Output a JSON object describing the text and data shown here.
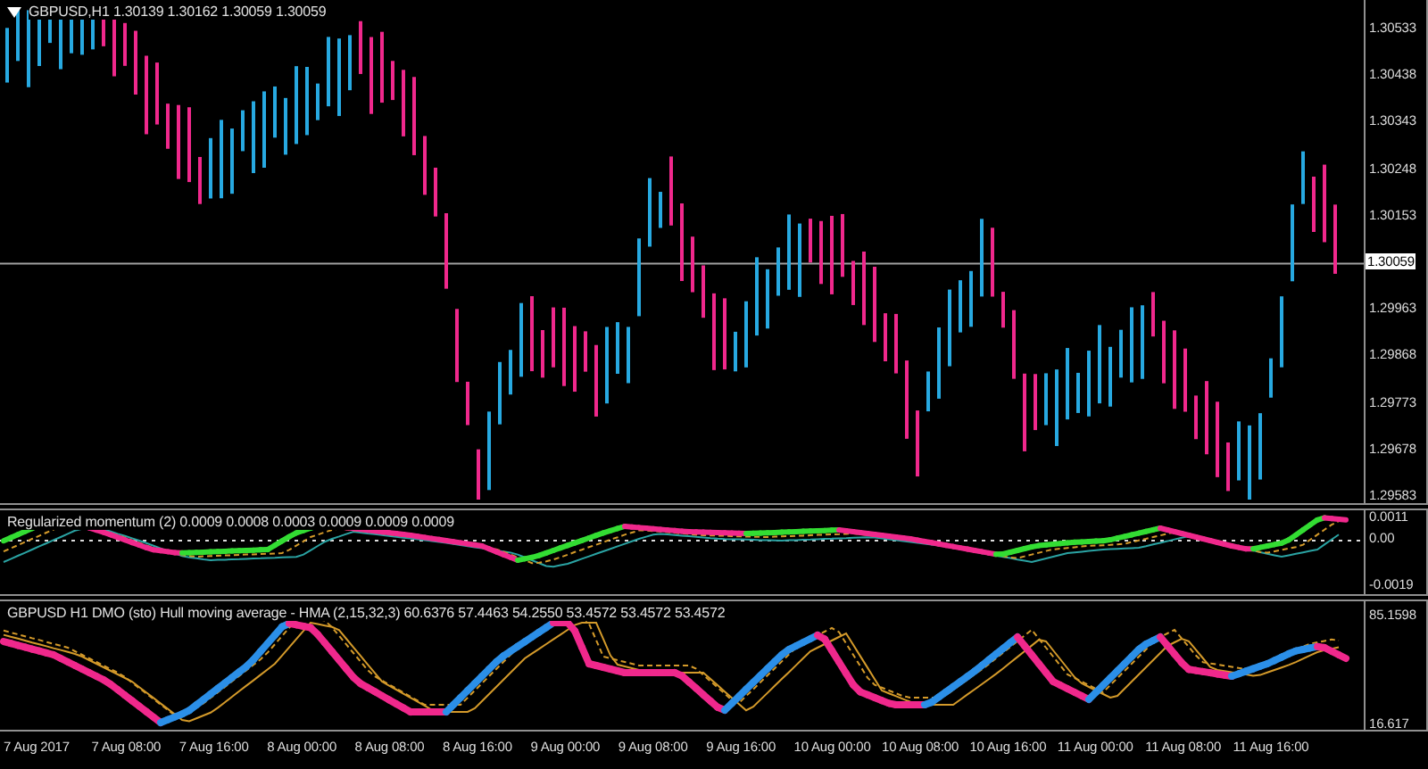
{
  "main_chart": {
    "header": "GBPUSD,H1  1.30139 1.30162 1.30059 1.30059",
    "price_axis": [
      "1.30533",
      "1.30438",
      "1.30343",
      "1.30248",
      "1.30153",
      "1.29963",
      "1.29868",
      "1.29773",
      "1.29678",
      "1.29583"
    ],
    "current_price": "1.30059"
  },
  "momentum_panel": {
    "header": "Regularized momentum (2) 0.0009 0.0008 0.0003 0.0009 0.0009 0.0009",
    "axis": [
      "0.0011",
      "0.00",
      "-0.0019"
    ]
  },
  "dmo_panel": {
    "header": "GBPUSD H1 DMO (sto) Hull moving average - HMA (2,15,32,3) 60.6376 57.4463 54.2550 53.4572 53.4572 53.4572",
    "axis": [
      "85.1598",
      "16.617"
    ]
  },
  "time_axis": [
    "7 Aug 2017",
    "7 Aug 08:00",
    "7 Aug 16:00",
    "8 Aug 00:00",
    "8 Aug 08:00",
    "8 Aug 16:00",
    "9 Aug 00:00",
    "9 Aug 08:00",
    "9 Aug 16:00",
    "10 Aug 00:00",
    "10 Aug 08:00",
    "10 Aug 16:00",
    "11 Aug 00:00",
    "11 Aug 08:00",
    "11 Aug 16:00"
  ]
}
